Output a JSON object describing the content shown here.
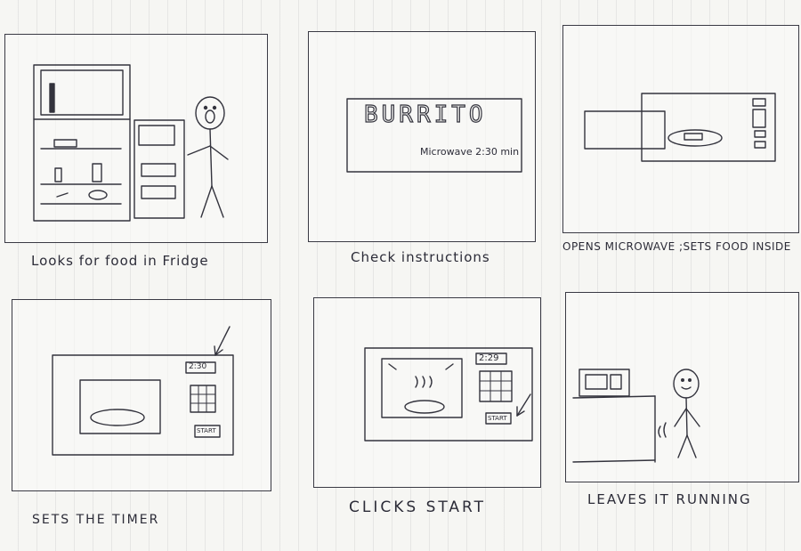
{
  "panels": [
    {
      "caption": "Looks for food in Fridge"
    },
    {
      "caption": "Check instructions",
      "sign_title": "BURRITO",
      "sign_subtitle": "Microwave 2:30 min"
    },
    {
      "caption": "OPENS MICROWAVE ;SETS FOOD INSIDE"
    },
    {
      "caption": "SETS THE TIMER",
      "display": "2:30",
      "start_label": "START"
    },
    {
      "caption": "CLICKS START",
      "display": "2:29",
      "start_label": "START"
    },
    {
      "caption": "LEAVES IT RUNNING"
    }
  ]
}
